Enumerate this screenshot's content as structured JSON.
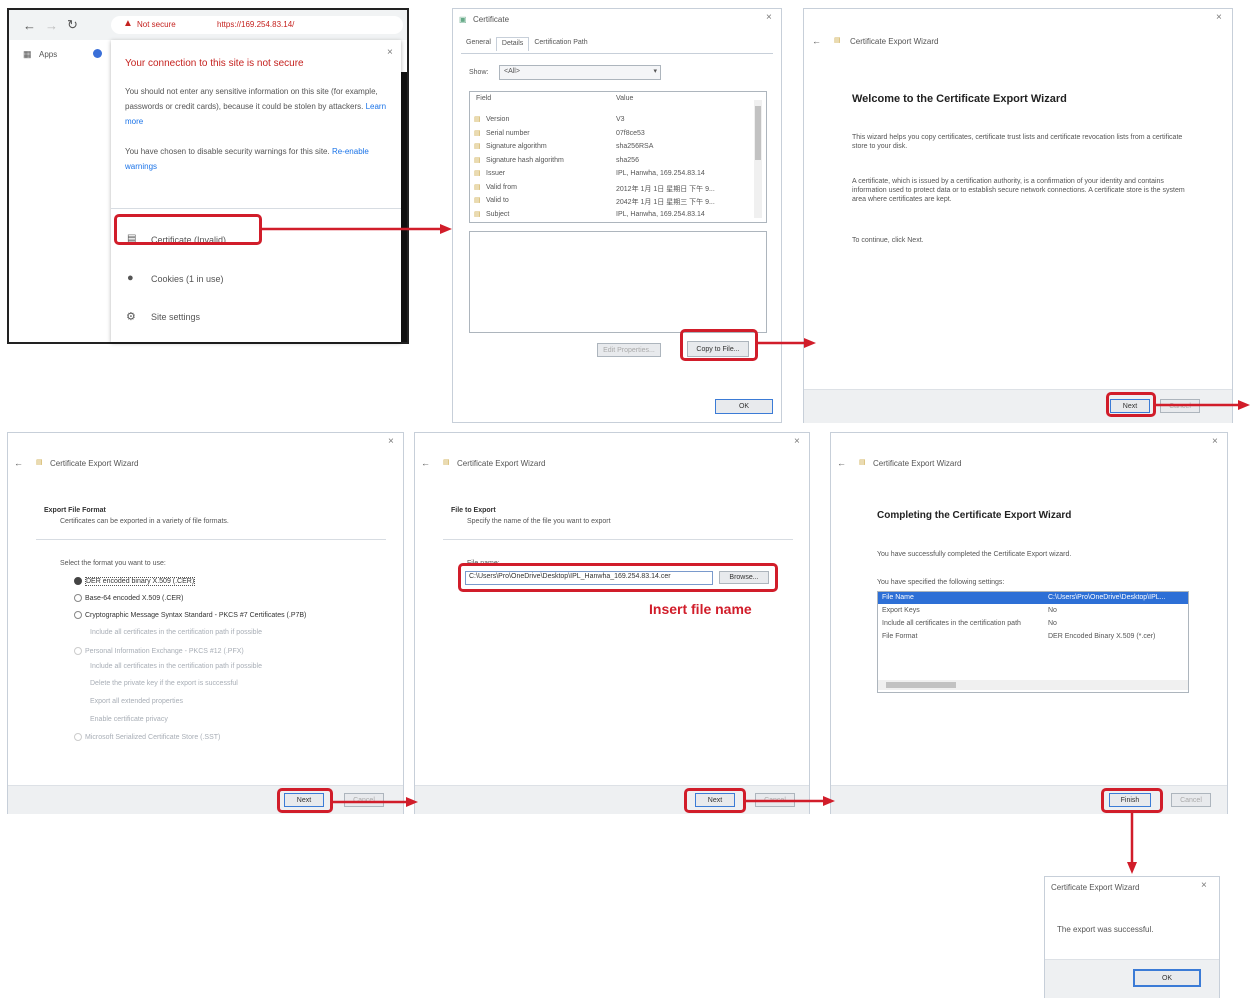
{
  "browser": {
    "not_secure": "Not secure",
    "url": "https://169.254.83.14/",
    "apps": "Apps",
    "popup": {
      "heading": "Your connection to this site is not secure",
      "para1": "You should not enter any sensitive information on this site (for example, passwords or credit cards), because it could be stolen by attackers.",
      "learn_more": "Learn more",
      "para2": "You have chosen to disable security warnings for this site.",
      "re_enable": "Re-enable warnings",
      "certificate": "Certificate (Invalid)",
      "cookies": "Cookies (1 in use)",
      "site_settings": "Site settings"
    }
  },
  "cert_dialog": {
    "title": "Certificate",
    "tabs": [
      "General",
      "Details",
      "Certification Path"
    ],
    "show_label": "Show:",
    "show_value": "<All>",
    "col_field": "Field",
    "col_value": "Value",
    "rows": [
      {
        "field": "Version",
        "value": "V3"
      },
      {
        "field": "Serial number",
        "value": "07f8ce53"
      },
      {
        "field": "Signature algorithm",
        "value": "sha256RSA"
      },
      {
        "field": "Signature hash algorithm",
        "value": "sha256"
      },
      {
        "field": "Issuer",
        "value": "IPL, Hanwha, 169.254.83.14"
      },
      {
        "field": "Valid from",
        "value": "2012年 1月 1日 星期日 下午 9..."
      },
      {
        "field": "Valid to",
        "value": "2042年 1月 1日 星期三 下午 9..."
      },
      {
        "field": "Subject",
        "value": "IPL, Hanwha, 169.254.83.14"
      }
    ],
    "edit_properties": "Edit Properties...",
    "copy_to_file": "Copy to File...",
    "ok": "OK"
  },
  "welcome": {
    "wizard_title": "Certificate Export Wizard",
    "heading": "Welcome to the Certificate Export Wizard",
    "p1": "This wizard helps you copy certificates, certificate trust lists and certificate revocation lists from a certificate store to your disk.",
    "p2": "A certificate, which is issued by a certification authority, is a confirmation of your identity and contains information used to protect data or to establish secure network connections. A certificate store is the system area where certificates are kept.",
    "p3": "To continue, click Next.",
    "next": "Next",
    "cancel": "Cancel"
  },
  "format": {
    "wizard_title": "Certificate Export Wizard",
    "section": "Export File Format",
    "section_sub": "Certificates can be exported in a variety of file formats.",
    "select": "Select the format you want to use:",
    "opt1": "DER encoded binary X.509 (.CER)",
    "opt2": "Base-64 encoded X.509 (.CER)",
    "opt3": "Cryptographic Message Syntax Standard - PKCS #7 Certificates (.P7B)",
    "opt3a": "Include all certificates in the certification path if possible",
    "opt4": "Personal Information Exchange - PKCS #12 (.PFX)",
    "opt4a": "Include all certificates in the certification path if possible",
    "opt4b": "Delete the private key if the export is successful",
    "opt4c": "Export all extended properties",
    "opt4d": "Enable certificate privacy",
    "opt5": "Microsoft Serialized Certificate Store (.SST)",
    "next": "Next",
    "cancel": "Cancel"
  },
  "file": {
    "wizard_title": "Certificate Export Wizard",
    "section": "File to Export",
    "section_sub": "Specify the name of the file you want to export",
    "file_name_label": "File name:",
    "file_name_value": "C:\\Users\\Pro\\OneDrive\\Desktop\\IPL_Hanwha_169.254.83.14.cer",
    "browse": "Browse...",
    "annotation": "Insert file name",
    "next": "Next",
    "cancel": "Cancel"
  },
  "complete": {
    "wizard_title": "Certificate Export Wizard",
    "heading": "Completing the Certificate Export Wizard",
    "p1": "You have successfully completed the Certificate Export wizard.",
    "p2": "You have specified the following settings:",
    "rows": [
      {
        "k": "File Name",
        "v": "C:\\Users\\Pro\\OneDrive\\Desktop\\IPL..."
      },
      {
        "k": "Export Keys",
        "v": "No"
      },
      {
        "k": "Include all certificates in the certification path",
        "v": "No"
      },
      {
        "k": "File Format",
        "v": "DER Encoded Binary X.509 (*.cer)"
      }
    ],
    "finish": "Finish",
    "cancel": "Cancel"
  },
  "success": {
    "title": "Certificate Export Wizard",
    "message": "The export was successful.",
    "ok": "OK"
  },
  "colors": {
    "highlight": "#d11d2a",
    "selection": "#2d6fd6",
    "link": "#1a73e8"
  }
}
